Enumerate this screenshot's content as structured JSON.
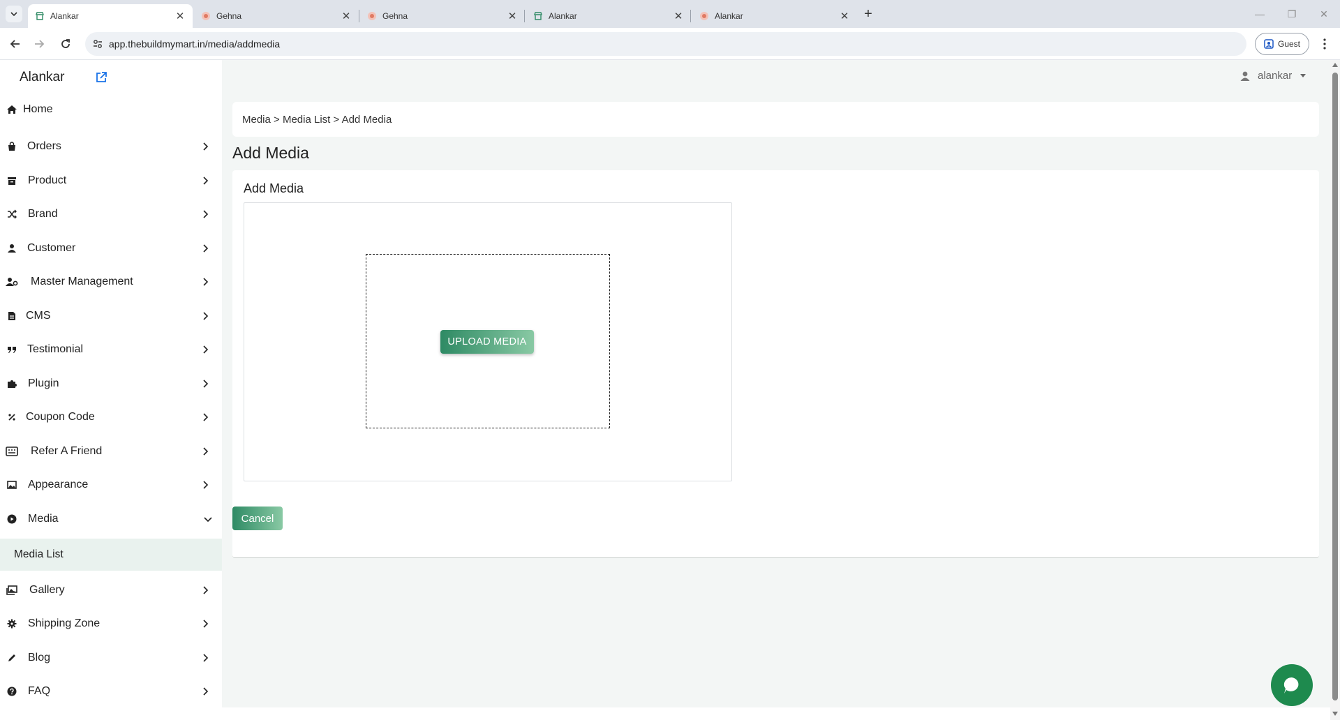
{
  "browser": {
    "tabs": [
      {
        "title": "Alankar",
        "active": true,
        "favicon": "store-icon"
      },
      {
        "title": "Gehna",
        "active": false,
        "favicon": "gehna-icon"
      },
      {
        "title": "Gehna",
        "active": false,
        "favicon": "gehna-icon"
      },
      {
        "title": "Alankar",
        "active": false,
        "favicon": "store-icon"
      },
      {
        "title": "Alankar",
        "active": false,
        "favicon": "gehna-icon"
      }
    ],
    "url": "app.thebuildmymart.in/media/addmedia",
    "profile_label": "Guest"
  },
  "app": {
    "brand": "Alankar",
    "user": "alankar",
    "colors": {
      "accent": "#2e8a64",
      "accent_light": "#89c9a4",
      "chat": "#1e8a4e",
      "active_bg": "#e9f2ee"
    }
  },
  "sidebar": {
    "items": [
      {
        "label": "Home",
        "icon": "home-icon"
      },
      {
        "label": "Orders",
        "icon": "bag-icon"
      },
      {
        "label": "Product",
        "icon": "box-icon"
      },
      {
        "label": "Brand",
        "icon": "shuffle-icon"
      },
      {
        "label": "Customer",
        "icon": "user-icon"
      },
      {
        "label": "Master Management",
        "icon": "user-gear-icon"
      },
      {
        "label": "CMS",
        "icon": "file-icon"
      },
      {
        "label": "Testimonial",
        "icon": "quote-icon"
      },
      {
        "label": "Plugin",
        "icon": "puzzle-icon"
      },
      {
        "label": "Coupon Code",
        "icon": "percent-icon"
      },
      {
        "label": "Refer A Friend",
        "icon": "keyboard-icon"
      },
      {
        "label": "Appearance",
        "icon": "image-icon"
      },
      {
        "label": "Media",
        "icon": "play-circle-icon"
      },
      {
        "label": "Gallery",
        "icon": "images-icon"
      },
      {
        "label": "Shipping Zone",
        "icon": "gear-icon"
      },
      {
        "label": "Blog",
        "icon": "pencil-icon"
      },
      {
        "label": "FAQ",
        "icon": "question-circle-icon"
      }
    ],
    "media_sub": {
      "label": "Media List"
    }
  },
  "breadcrumb": {
    "path": "Media > Media List > Add Media"
  },
  "page": {
    "title": "Add Media",
    "card_title": "Add Media",
    "upload_label": "UPLOAD MEDIA",
    "cancel_label": "Cancel"
  }
}
